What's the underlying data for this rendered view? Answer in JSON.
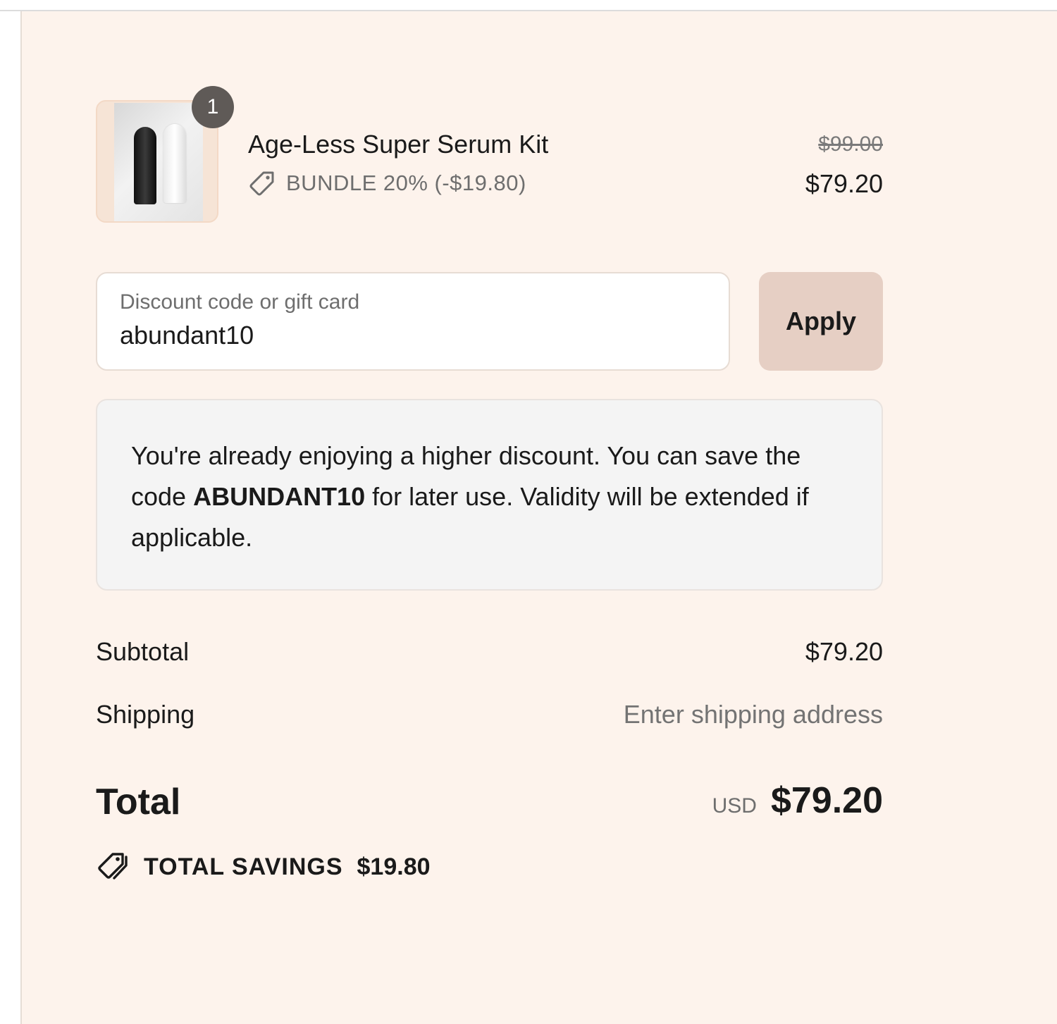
{
  "product": {
    "quantity": "1",
    "title": "Age-Less Super Serum Kit",
    "discount_text": "BUNDLE 20% (-$19.80)",
    "original_price": "$99.00",
    "current_price": "$79.20",
    "image_icon": "product-thumbnail"
  },
  "discount": {
    "label": "Discount code or gift card",
    "value": "abundant10",
    "apply_label": "Apply"
  },
  "notice": {
    "text_before": "You're already enjoying a higher discount. You can save the code ",
    "code": "ABUNDANT10",
    "text_after": " for later use. Validity will be extended if applicable."
  },
  "summary": {
    "subtotal_label": "Subtotal",
    "subtotal_value": "$79.20",
    "shipping_label": "Shipping",
    "shipping_value": "Enter shipping address",
    "total_label": "Total",
    "currency": "USD",
    "total_value": "$79.20",
    "savings_label": "TOTAL SAVINGS",
    "savings_value": "$19.80"
  },
  "colors": {
    "panel_background": "#fdf3ec",
    "apply_button": "#e6cfc4",
    "notice_background": "#f4f4f4",
    "badge": "#5f5a57"
  }
}
